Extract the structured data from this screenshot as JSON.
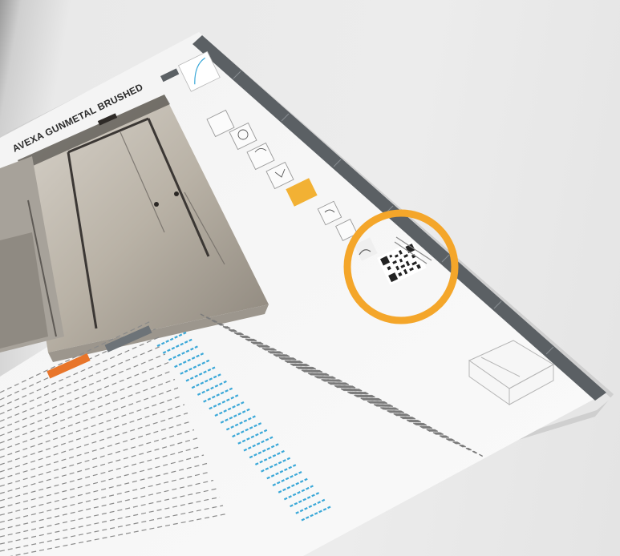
{
  "catalog": {
    "product_title": "AVEXA GUNMETAL BRUSHED"
  },
  "colors": {
    "highlight_ring": "#F4A62A",
    "tab_strip": "#5b6064",
    "table_accent_blue": "#3aa8d8",
    "accent_orange": "#e8752a"
  }
}
